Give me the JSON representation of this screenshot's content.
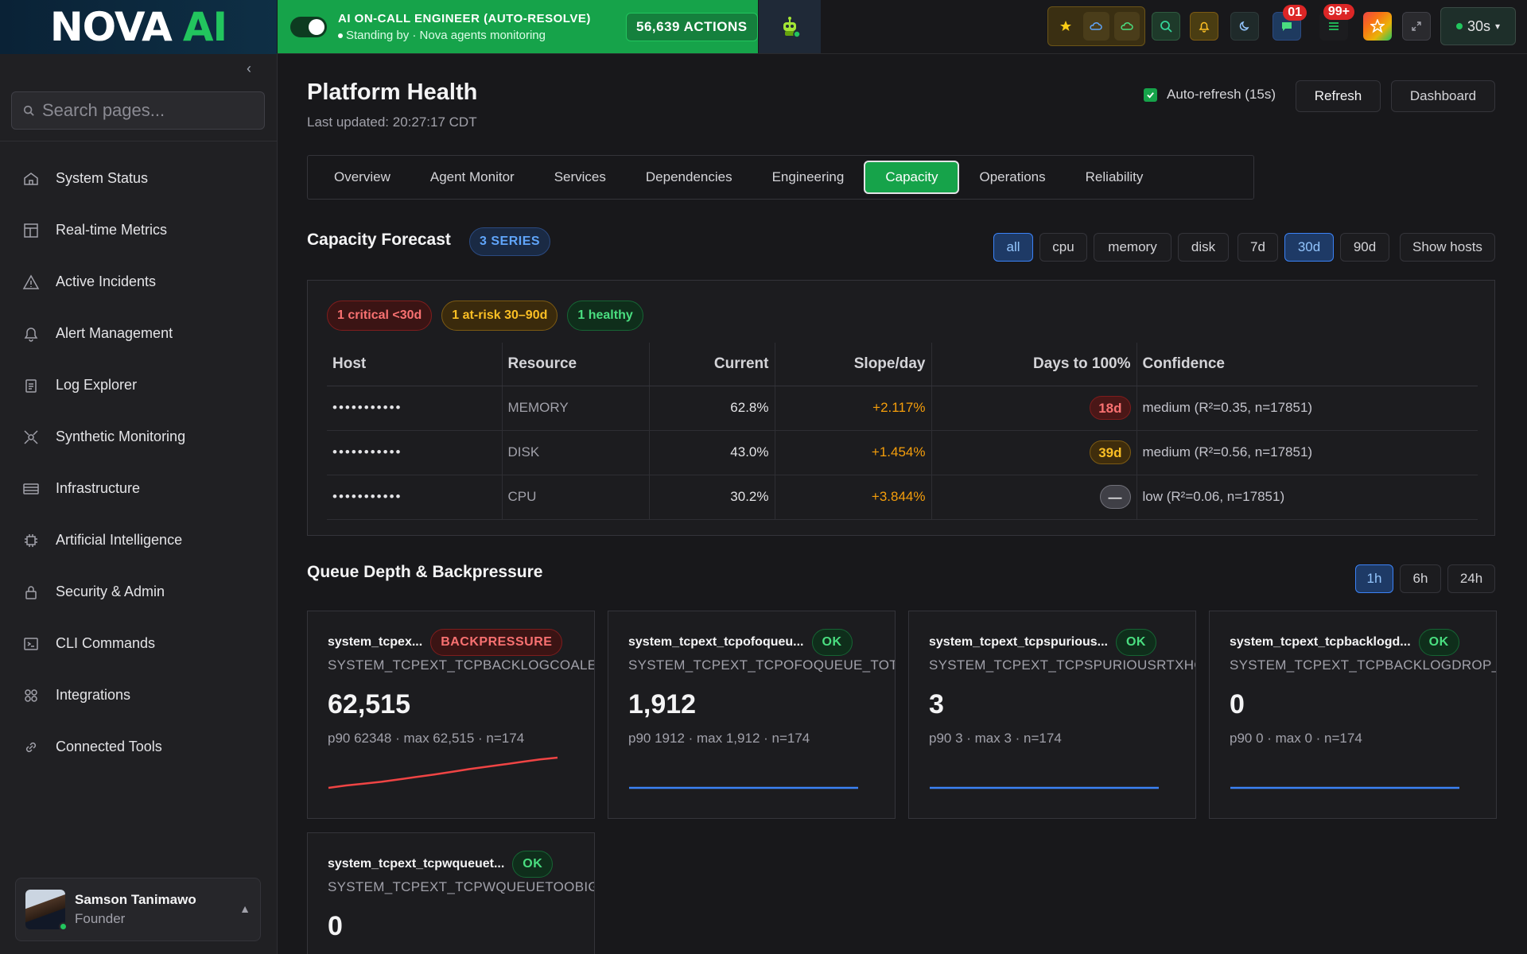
{
  "brand": {
    "word1": "NOVA",
    "word2": "AI"
  },
  "oncall": {
    "title": "AI ON-CALL ENGINEER (AUTO-RESOLVE)",
    "subtitle": "Standing by · Nova agents monitoring",
    "actions": "56,639 ACTIONS"
  },
  "toolbar": {
    "badge_count_1": "01",
    "badge_count_2": "99+",
    "refresh_interval": "30s"
  },
  "sidebar": {
    "search_placeholder": "Search pages...",
    "items": [
      {
        "label": "System Status",
        "icon": "home-icon"
      },
      {
        "label": "Real-time Metrics",
        "icon": "layout-icon"
      },
      {
        "label": "Active Incidents",
        "icon": "warning-icon"
      },
      {
        "label": "Alert Management",
        "icon": "bell-icon"
      },
      {
        "label": "Log Explorer",
        "icon": "clipboard-icon"
      },
      {
        "label": "Synthetic Monitoring",
        "icon": "radar-icon"
      },
      {
        "label": "Infrastructure",
        "icon": "server-icon"
      },
      {
        "label": "Artificial Intelligence",
        "icon": "cpu-icon"
      },
      {
        "label": "Security & Admin",
        "icon": "lock-icon"
      },
      {
        "label": "CLI Commands",
        "icon": "terminal-icon"
      },
      {
        "label": "Integrations",
        "icon": "grid-icon"
      },
      {
        "label": "Connected Tools",
        "icon": "link-icon"
      }
    ],
    "user": {
      "name": "Samson Tanimawo",
      "role": "Founder"
    }
  },
  "page": {
    "title": "Platform Health",
    "last_updated": "Last updated: 20:27:17 CDT",
    "auto_refresh_label": "Auto-refresh (15s)",
    "refresh_label": "Refresh",
    "dashboard_label": "Dashboard",
    "tabs": [
      "Overview",
      "Agent Monitor",
      "Services",
      "Dependencies",
      "Engineering",
      "Capacity",
      "Operations",
      "Reliability"
    ],
    "active_tab": "Capacity"
  },
  "capacity": {
    "title": "Capacity Forecast",
    "series_pill": "3 SERIES",
    "filters": [
      "all",
      "cpu",
      "memory",
      "disk"
    ],
    "ranges": [
      "7d",
      "30d",
      "90d"
    ],
    "show_hosts_label": "Show hosts",
    "summary": {
      "critical": "1 critical <30d",
      "at_risk": "1 at-risk 30–90d",
      "healthy": "1 healthy"
    },
    "columns": [
      "Host",
      "Resource",
      "Current",
      "Slope/day",
      "Days to 100%",
      "Confidence"
    ],
    "rows": [
      {
        "host": "•••••••••••",
        "resource": "MEMORY",
        "current": "62.8%",
        "slope": "+2.117%",
        "days": "18d",
        "status": "red",
        "confidence": "medium (R²=0.35, n=17851)"
      },
      {
        "host": "•••••••••••",
        "resource": "DISK",
        "current": "43.0%",
        "slope": "+1.454%",
        "days": "39d",
        "status": "amber",
        "confidence": "medium (R²=0.56, n=17851)"
      },
      {
        "host": "•••••••••••",
        "resource": "CPU",
        "current": "30.2%",
        "slope": "+3.844%",
        "days": "—",
        "status": "gray",
        "confidence": "low (R²=0.06, n=17851)"
      }
    ]
  },
  "queue": {
    "title": "Queue Depth & Backpressure",
    "ranges": [
      "1h",
      "6h",
      "24h"
    ],
    "cards": [
      {
        "name": "system_tcpex...",
        "metric": "SYSTEM_TCPEXT_TCPBACKLOGCOALESCE",
        "badge": "BACKPRESSURE",
        "value": "62,515",
        "stats": "p90 62348 · max 62,515 · n=174",
        "trend": [
          0,
          8,
          14,
          20,
          28,
          36,
          44,
          53,
          62,
          70,
          78,
          86,
          94,
          100
        ]
      },
      {
        "name": "system_tcpext_tcpofoqueu...",
        "metric": "SYSTEM_TCPEXT_TCPOFOQUEUE_TOTAL",
        "badge": "OK",
        "value": "1,912",
        "stats": "p90 1912 · max 1,912 · n=174",
        "trend": []
      },
      {
        "name": "system_tcpext_tcpspurious...",
        "metric": "SYSTEM_TCPEXT_TCPSPURIOUSRTXHOSTQUEUES",
        "badge": "OK",
        "value": "3",
        "stats": "p90 3 · max 3 · n=174",
        "trend": []
      },
      {
        "name": "system_tcpext_tcpbacklogd...",
        "metric": "SYSTEM_TCPEXT_TCPBACKLOGDROP_TOTAL",
        "badge": "OK",
        "value": "0",
        "stats": "p90 0 · max 0 · n=174",
        "trend": []
      },
      {
        "name": "system_tcpext_tcpwqueuet...",
        "metric": "SYSTEM_TCPEXT_TCPWQUEUETOOBIG_TOTAL",
        "badge": "OK",
        "value": "0",
        "stats": "",
        "trend": []
      }
    ]
  }
}
